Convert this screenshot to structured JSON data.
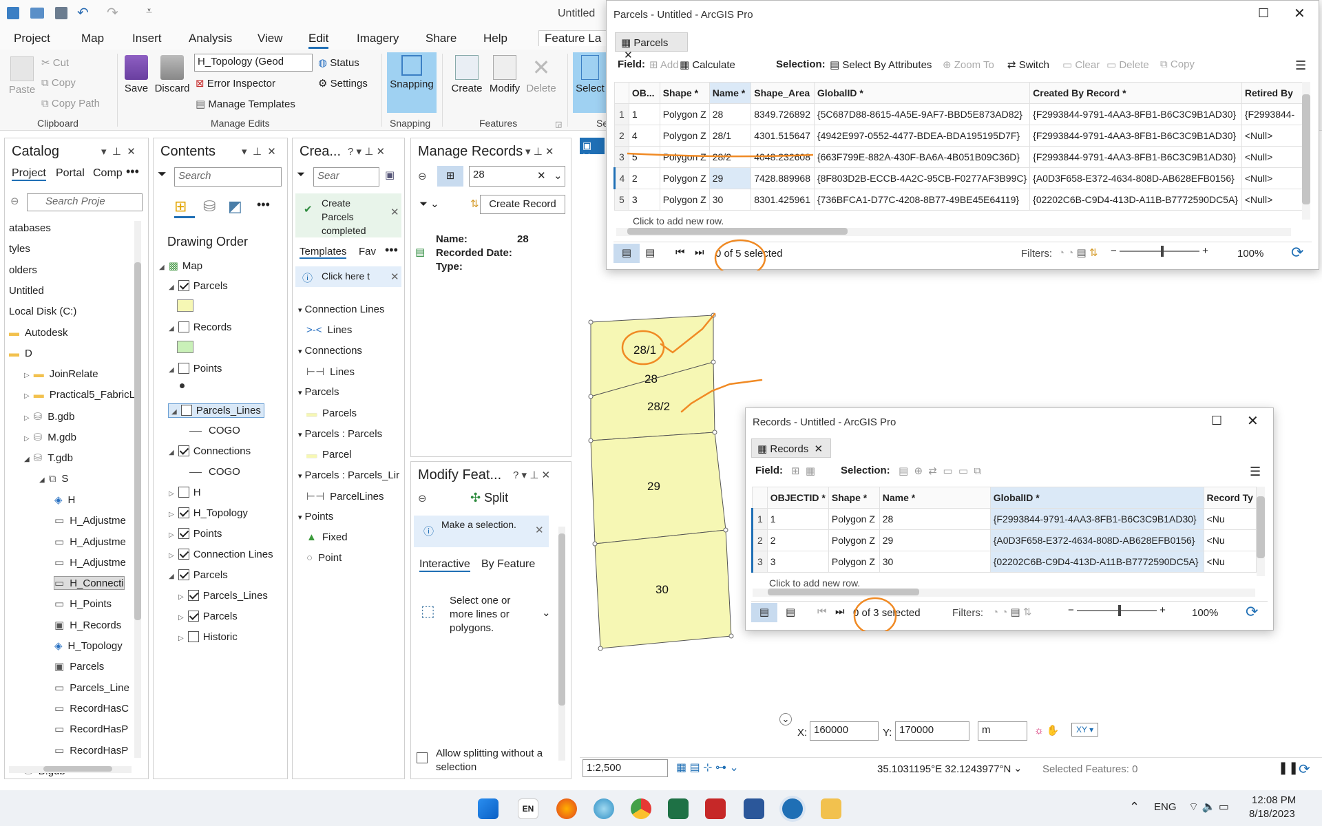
{
  "app": {
    "title": "Untitled"
  },
  "ribbon_tabs": [
    "Project",
    "Map",
    "Insert",
    "Analysis",
    "View",
    "Edit",
    "Imagery",
    "Share",
    "Help",
    "Feature La"
  ],
  "ribbon": {
    "clipboard": {
      "paste": "Paste",
      "cut": "Cut",
      "copy": "Copy",
      "copy_path": "Copy Path",
      "group": "Clipboard"
    },
    "manage_edits": {
      "save": "Save",
      "discard": "Discard",
      "topology": "H_Topology (Geod",
      "status": "Status",
      "error_inspector": "Error Inspector",
      "settings": "Settings",
      "manage_templates": "Manage Templates",
      "group": "Manage Edits"
    },
    "snapping": {
      "label": "Snapping",
      "group": "Snapping"
    },
    "features": {
      "create": "Create",
      "modify": "Modify",
      "delete": "Delete",
      "group": "Features"
    },
    "select": {
      "label": "Select",
      "group": "Se"
    }
  },
  "catalog": {
    "title": "Catalog",
    "tabs": [
      "Project",
      "Portal",
      "Comp"
    ],
    "search_placeholder": "Search Proje",
    "items": [
      "atabases",
      "tyles",
      "olders",
      "Untitled",
      "Local Disk (C:)",
      "Autodesk",
      "D",
      "JoinRelate",
      "Practical5_FabricL",
      "B.gdb",
      "M.gdb",
      "T.gdb",
      "S",
      "H",
      "H_Adjustme",
      "H_Adjustme",
      "H_Adjustme",
      "H_Connecti",
      "H_Points",
      "H_Records",
      "H_Topology",
      "Parcels",
      "Parcels_Line",
      "RecordHasC",
      "RecordHasP",
      "RecordHasP",
      "B.gdb"
    ]
  },
  "contents": {
    "title": "Contents",
    "search_placeholder": "Search",
    "drawing_order": "Drawing Order",
    "layers": [
      "Map",
      "Parcels",
      "Records",
      "Points",
      "Parcels_Lines",
      "COGO",
      "Connections",
      "COGO",
      "H",
      "H_Topology",
      "Points",
      "Connection Lines",
      "Parcels",
      "Parcels_Lines",
      "Parcels",
      "Historic"
    ]
  },
  "create_pane": {
    "title": "Crea...",
    "search_placeholder": "Sear",
    "toast": "Create Parcels completed",
    "tabs": [
      "Templates",
      "Fav"
    ],
    "info": "Click here t",
    "items": [
      "Connection Lines",
      "Lines",
      "Connections",
      "Lines",
      "Parcels",
      "Parcels",
      "Parcels : Parcels",
      "Parcel",
      "Parcels : Parcels_Lir",
      "ParcelLines",
      "Points",
      "Fixed",
      "Point"
    ]
  },
  "manage_records": {
    "title": "Manage Records",
    "search_value": "28",
    "create_button": "Create Record",
    "name_label": "Name:",
    "name_value": "28",
    "recorded_date_label": "Recorded Date:",
    "type_label": "Type:"
  },
  "modify_features": {
    "title": "Modify Feat...",
    "tool": "Split",
    "info": "Make a selection.",
    "tabs": [
      "Interactive",
      "By Feature"
    ],
    "hint": "Select one or more lines or polygons.",
    "allow_label": "Allow splitting without a selection"
  },
  "parcels_window": {
    "title": "Parcels - Untitled - ArcGIS Pro",
    "tab": "Parcels",
    "toolbar": {
      "field": "Field:",
      "add": "Add",
      "calculate": "Calculate",
      "selection": "Selection:",
      "select_by_attr": "Select By Attributes",
      "zoom_to": "Zoom To",
      "switch": "Switch",
      "clear": "Clear",
      "delete": "Delete",
      "copy": "Copy"
    },
    "columns": [
      "OB...",
      "Shape *",
      "Name *",
      "Shape_Area",
      "GlobalID *",
      "Created By Record *",
      "Retired By"
    ],
    "rows": [
      [
        "1",
        "1",
        "Polygon Z",
        "28",
        "8349.726892",
        "{5C687D88-8615-4A5E-9AF7-BBD5E873AD82}",
        "{F2993844-9791-4AA3-8FB1-B6C3C9B1AD30}",
        "{F2993844-"
      ],
      [
        "2",
        "4",
        "Polygon Z",
        "28/1",
        "4301.515647",
        "{4942E997-0552-4477-BDEA-BDA195195D7F}",
        "{F2993844-9791-4AA3-8FB1-B6C3C9B1AD30}",
        "<Null>"
      ],
      [
        "3",
        "5",
        "Polygon Z",
        "28/2",
        "4048.232608",
        "{663F799E-882A-430F-BA6A-4B051B09C36D}",
        "{F2993844-9791-4AA3-8FB1-B6C3C9B1AD30}",
        "<Null>"
      ],
      [
        "4",
        "2",
        "Polygon Z",
        "29",
        "7428.889968",
        "{8F803D2B-ECCB-4A2C-95CB-F0277AF3B99C}",
        "{A0D3F658-E372-4634-808D-AB628EFB0156}",
        "<Null>"
      ],
      [
        "5",
        "3",
        "Polygon Z",
        "30",
        "8301.425961",
        "{736BFCA1-D77C-4208-8B77-49BE45E64119}",
        "{02202C6B-C9D4-413D-A11B-B7772590DC5A}",
        "<Null>"
      ]
    ],
    "add_row": "Click to add new row.",
    "selected": "0 of 5 selected",
    "filters": "Filters:",
    "zoom": "100%"
  },
  "records_window": {
    "title": "Records - Untitled - ArcGIS Pro",
    "tab": "Records",
    "toolbar": {
      "field": "Field:",
      "selection": "Selection:"
    },
    "columns": [
      "OBJECTID *",
      "Shape *",
      "Name *",
      "GlobalID *",
      "Record Ty"
    ],
    "rows": [
      [
        "1",
        "1",
        "Polygon Z",
        "28",
        "{F2993844-9791-4AA3-8FB1-B6C3C9B1AD30}",
        "<Nu"
      ],
      [
        "2",
        "2",
        "Polygon Z",
        "29",
        "{A0D3F658-E372-4634-808D-AB628EFB0156}",
        "<Nu"
      ],
      [
        "3",
        "3",
        "Polygon Z",
        "30",
        "{02202C6B-C9D4-413D-A11B-B7772590DC5A}",
        "<Nu"
      ]
    ],
    "add_row": "Click to add new row.",
    "selected": "0 of 3 selected",
    "filters": "Filters:",
    "zoom": "100%"
  },
  "map": {
    "labels": [
      "28/1",
      "28",
      "28/2",
      "29",
      "30"
    ],
    "x_label": "X:",
    "x_value": "160000",
    "y_label": "Y:",
    "y_value": "170000",
    "unit": "m",
    "scale": "1:2,500",
    "coords": "35.1031195°E 32.1243977°N",
    "selected_features": "Selected Features: 0"
  },
  "taskbar": {
    "lang": "ENG",
    "time": "12:08 PM",
    "date": "8/18/2023",
    "en": "EN"
  },
  "colors": {
    "parcel_fill": "#f6f7b4",
    "annotation": "#f08a24",
    "accent": "#1f6fb5"
  }
}
